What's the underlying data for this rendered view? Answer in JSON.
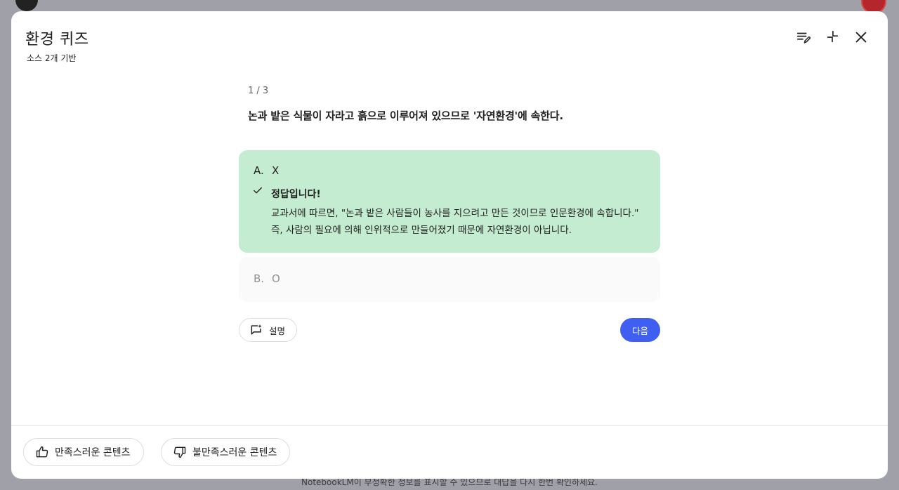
{
  "dialog": {
    "title": "환경 퀴즈",
    "subtitle": "소스 2개 기반",
    "header_icons": [
      "edit-list-icon",
      "collapse-icon",
      "close-icon"
    ]
  },
  "quiz": {
    "counter": "1 / 3",
    "question": "논과 밭은 식물이 자라고 흙으로 이루어져 있으므로 '자연환경'에 속한다.",
    "options": [
      {
        "letter": "A.",
        "text": "X",
        "state": "correct",
        "feedback_title": "정답입니다!",
        "feedback_text": "교과서에 따르면, \"논과 밭은 사람들이 농사를 지으려고 만든 것이므로 인문환경에 속합니다.\" 즉, 사람의 필요에 의해 인위적으로 만들어졌기 때문에 자연환경이 아닙니다."
      },
      {
        "letter": "B.",
        "text": "O",
        "state": "disabled"
      }
    ],
    "explain_label": "설명",
    "next_label": "다음"
  },
  "feedback": {
    "positive_label": "만족스러운 콘텐츠",
    "negative_label": "불만족스러운 콘텐츠"
  },
  "background": {
    "disclaimer": "NotebookLM이 부정확한 정보를 표시할 수 있으므로 대답을 다시 한번 확인하세요."
  },
  "colors": {
    "correct_bg": "#c4ecd0",
    "primary": "#3f5ff2",
    "overlay": "#a0a1a8"
  }
}
